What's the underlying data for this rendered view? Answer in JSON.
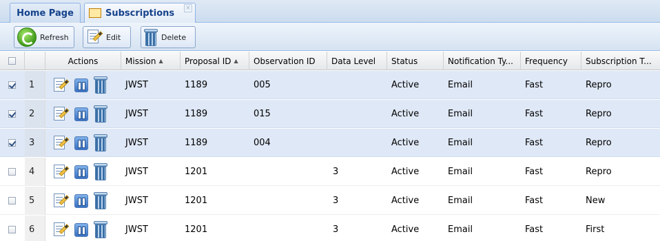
{
  "tabs": [
    {
      "label": "Home Page"
    },
    {
      "label": "Subscriptions",
      "close_glyph": "×"
    }
  ],
  "toolbar": {
    "refresh_label": "Refresh",
    "edit_label": "Edit",
    "delete_label": "Delete"
  },
  "columns": {
    "actions": "Actions",
    "mission": "Mission",
    "proposal_id": "Proposal ID",
    "observation_id": "Observation ID",
    "data_level": "Data Level",
    "status": "Status",
    "notification_type": "Notification Ty...",
    "frequency": "Frequency",
    "subscription_type": "Subscription T...",
    "sort_glyph": "▲"
  },
  "rows": [
    {
      "n": "1",
      "checked": true,
      "mission": "JWST",
      "proposal_id": "1189",
      "observation_id": "005",
      "data_level": "",
      "status": "Active",
      "notification_type": "Email",
      "frequency": "Fast",
      "subscription_type": "Repro"
    },
    {
      "n": "2",
      "checked": true,
      "mission": "JWST",
      "proposal_id": "1189",
      "observation_id": "015",
      "data_level": "",
      "status": "Active",
      "notification_type": "Email",
      "frequency": "Fast",
      "subscription_type": "Repro"
    },
    {
      "n": "3",
      "checked": true,
      "mission": "JWST",
      "proposal_id": "1189",
      "observation_id": "004",
      "data_level": "",
      "status": "Active",
      "notification_type": "Email",
      "frequency": "Fast",
      "subscription_type": "Repro"
    },
    {
      "n": "4",
      "checked": false,
      "mission": "JWST",
      "proposal_id": "1201",
      "observation_id": "",
      "data_level": "3",
      "status": "Active",
      "notification_type": "Email",
      "frequency": "Fast",
      "subscription_type": "Repro"
    },
    {
      "n": "5",
      "checked": false,
      "mission": "JWST",
      "proposal_id": "1201",
      "observation_id": "",
      "data_level": "3",
      "status": "Active",
      "notification_type": "Email",
      "frequency": "Fast",
      "subscription_type": "New"
    },
    {
      "n": "6",
      "checked": false,
      "mission": "JWST",
      "proposal_id": "1201",
      "observation_id": "",
      "data_level": "3",
      "status": "Active",
      "notification_type": "Email",
      "frequency": "Fast",
      "subscription_type": "First"
    }
  ]
}
